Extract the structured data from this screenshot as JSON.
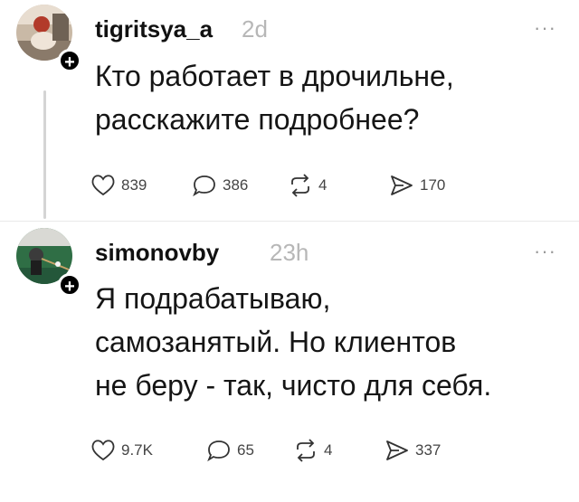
{
  "posts": [
    {
      "username": "tigritsya_a",
      "time": "2d",
      "text_lines": [
        "Кто работает в дрочильне,",
        "расскажите подробнее?"
      ],
      "stats": {
        "likes": "839",
        "comments": "386",
        "reposts": "4",
        "shares": "170"
      }
    },
    {
      "username": "simonovby",
      "time": "23h",
      "text_lines": [
        "Я подрабатываю,",
        "самозанятый. Но клиентов",
        "не беру - так, чисто для себя."
      ],
      "stats": {
        "likes": "9.7K",
        "comments": "65",
        "reposts": "4",
        "shares": "337"
      }
    }
  ],
  "icons": {
    "like": "heart-icon",
    "comment": "comment-bubble-icon",
    "repost": "repost-icon",
    "share": "send-icon",
    "more": "more-options-icon",
    "follow": "plus-icon"
  },
  "ui": {
    "more_glyph": "···",
    "follow_glyph": "+"
  }
}
